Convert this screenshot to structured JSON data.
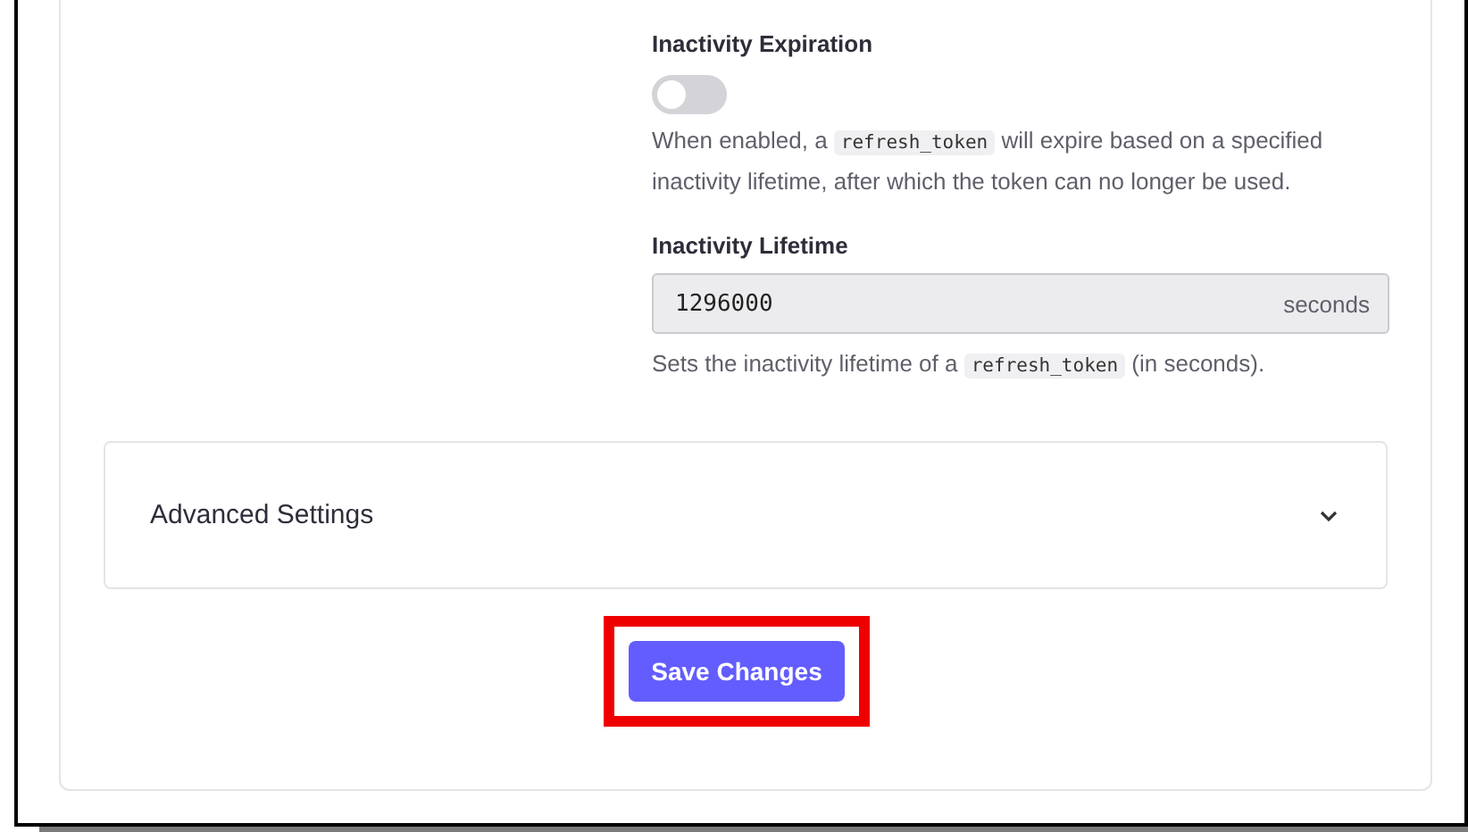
{
  "inactivity_expiration": {
    "label": "Inactivity Expiration",
    "toggle": {
      "on": false
    },
    "description": [
      {
        "kind": "text",
        "text": "When enabled, a "
      },
      {
        "kind": "code",
        "text": "refresh_token"
      },
      {
        "kind": "text",
        "text": " will expire based on a specified inactivity lifetime, after which the token can no longer be used."
      }
    ]
  },
  "inactivity_lifetime": {
    "label": "Inactivity Lifetime",
    "value": "1296000",
    "suffix": "seconds",
    "description": [
      {
        "kind": "text",
        "text": "Sets the inactivity lifetime of a "
      },
      {
        "kind": "code",
        "text": "refresh_token"
      },
      {
        "kind": "text",
        "text": " (in seconds)."
      }
    ]
  },
  "advanced_settings": {
    "title": "Advanced Settings",
    "expanded": false
  },
  "save_button": {
    "label": "Save Changes",
    "highlighted": true
  }
}
